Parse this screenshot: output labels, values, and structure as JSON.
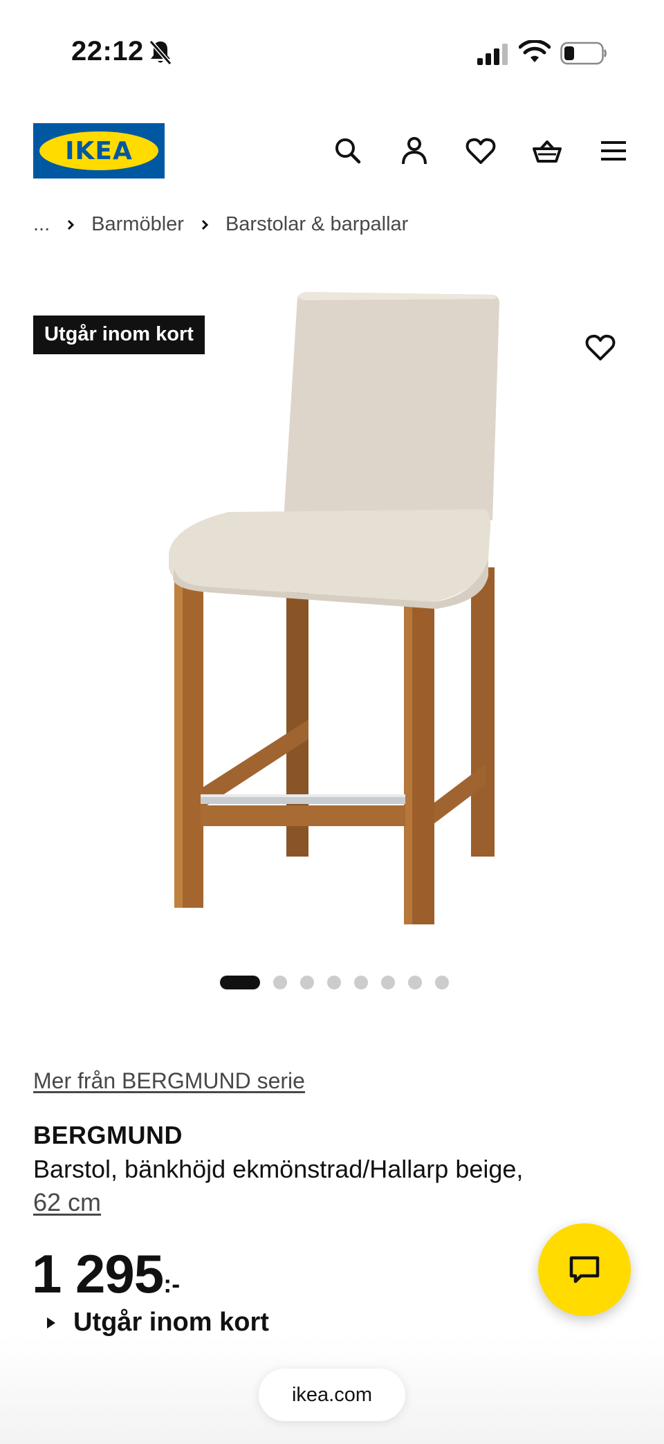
{
  "status_bar": {
    "time": "22:12",
    "icons": [
      "bell-off-icon",
      "signal-icon",
      "wifi-icon",
      "battery-icon"
    ]
  },
  "header": {
    "logo_text": "IKEA",
    "icons": [
      "search-icon",
      "account-icon",
      "heart-icon",
      "basket-icon",
      "menu-icon"
    ],
    "colors": {
      "logo_blue": "#0058A3",
      "logo_yellow": "#FFDB00"
    }
  },
  "breadcrumb": {
    "items": [
      "...",
      "Barmöbler",
      "Barstolar & barpallar"
    ]
  },
  "product_image": {
    "badge": "Utgår inom kort",
    "carousel_total": 8,
    "carousel_active": 1
  },
  "product": {
    "series_link": "Mer från BERGMUND serie",
    "name": "BERGMUND",
    "description": "Barstol, bänkhöjd ekmönstrad/Hallarp beige,",
    "size": "62 cm",
    "price": "1 295",
    "price_suffix": ":-",
    "availability": "Utgår inom kort"
  },
  "chat": {
    "icon": "chat-icon",
    "color": "#FFDB00"
  },
  "browser": {
    "url": "ikea.com"
  }
}
